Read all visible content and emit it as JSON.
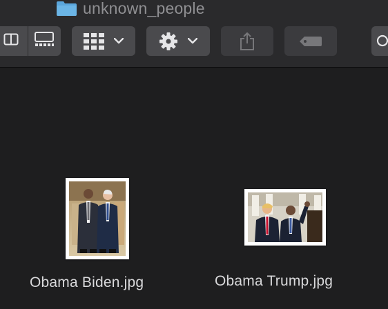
{
  "window": {
    "title": "unknown_people"
  },
  "toolbar": {
    "view_buttons": [
      {
        "icon": "column-view-icon"
      },
      {
        "icon": "gallery-view-icon"
      }
    ],
    "group_button": {
      "icon": "grid-group-icon",
      "chevron": "chevron-down-icon"
    },
    "action_button": {
      "icon": "gear-icon",
      "chevron": "chevron-down-icon"
    },
    "share_button": {
      "icon": "share-icon"
    },
    "tag_button": {
      "icon": "tag-icon"
    },
    "search_button": {
      "icon": "search-icon"
    }
  },
  "files": [
    {
      "name": "Obama Biden.jpg",
      "orientation": "portrait"
    },
    {
      "name": "Obama Trump.jpg",
      "orientation": "landscape"
    }
  ],
  "colors": {
    "background": "#1e1e1f",
    "toolbar": "#2a2a2c",
    "button": "#4a4a4d",
    "folder": "#5aa6dc",
    "filename": "#d9d9db"
  }
}
